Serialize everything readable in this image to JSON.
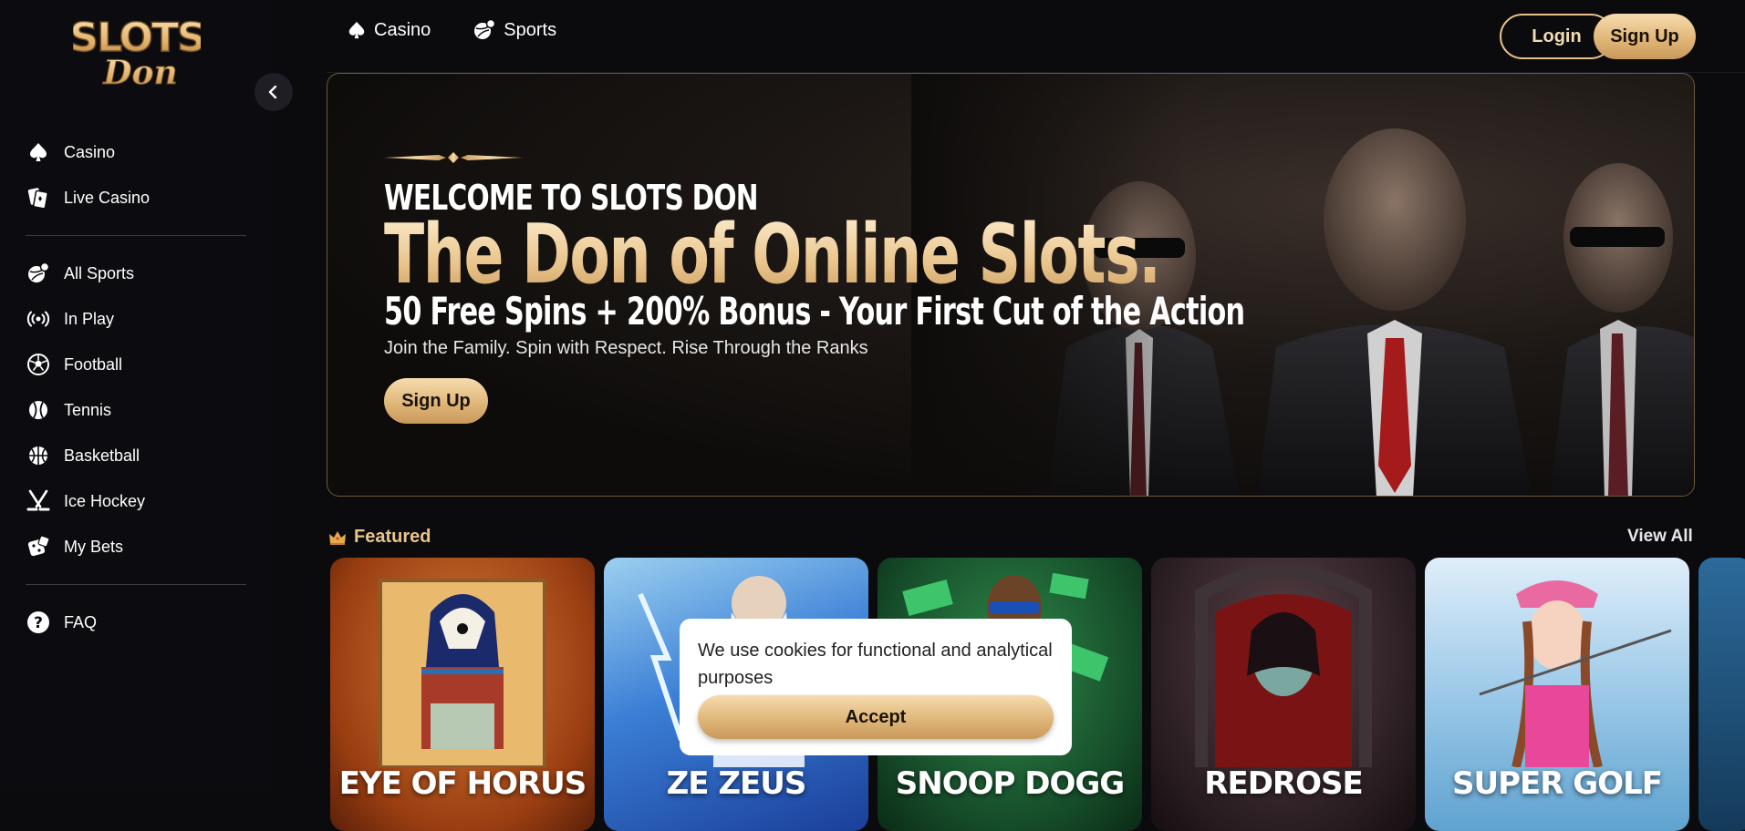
{
  "brand": {
    "logo_line1": "SLOTS",
    "logo_line2": "Don"
  },
  "sidebar": {
    "groups": [
      [
        {
          "label": "Casino",
          "icon": "spade-icon"
        },
        {
          "label": "Live Casino",
          "icon": "cards-icon"
        }
      ],
      [
        {
          "label": "All Sports",
          "icon": "sports-icon"
        },
        {
          "label": "In Play",
          "icon": "live-signal-icon"
        },
        {
          "label": "Football",
          "icon": "football-icon"
        },
        {
          "label": "Tennis",
          "icon": "tennis-icon"
        },
        {
          "label": "Basketball",
          "icon": "basketball-icon"
        },
        {
          "label": "Ice Hockey",
          "icon": "hockey-icon"
        },
        {
          "label": "My Bets",
          "icon": "dice-icon"
        }
      ],
      [
        {
          "label": "FAQ",
          "icon": "question-icon"
        }
      ]
    ]
  },
  "topnav": {
    "casino": "Casino",
    "sports": "Sports",
    "login": "Login",
    "signup": "Sign Up"
  },
  "hero": {
    "eyebrow": "WELCOME TO SLOTS DON",
    "title": "The Don of Online Slots.",
    "subtitle": "50 Free Spins + 200% Bonus - Your First Cut of the Action",
    "tagline": "Join the Family. Spin with Respect. Rise Through the Ranks",
    "cta": "Sign Up"
  },
  "featured": {
    "title": "Featured",
    "view_all": "View All",
    "games": [
      {
        "name": "EYE OF HORUS",
        "bg": "#b5561e"
      },
      {
        "name": "ZE ZEUS",
        "bg": "#2f6fd0"
      },
      {
        "name": "SNOOP DOGG",
        "bg": "#1f6e3a"
      },
      {
        "name": "REDROSE",
        "bg": "#3a2a30"
      },
      {
        "name": "SUPER GOLF",
        "bg": "#8dbde0"
      }
    ]
  },
  "cookie": {
    "text": "We use cookies for functional and analytical purposes",
    "accept": "Accept"
  },
  "colors": {
    "gold_light": "#f6dcae",
    "gold_dark": "#c9995b",
    "bg": "#0b0b0e"
  }
}
